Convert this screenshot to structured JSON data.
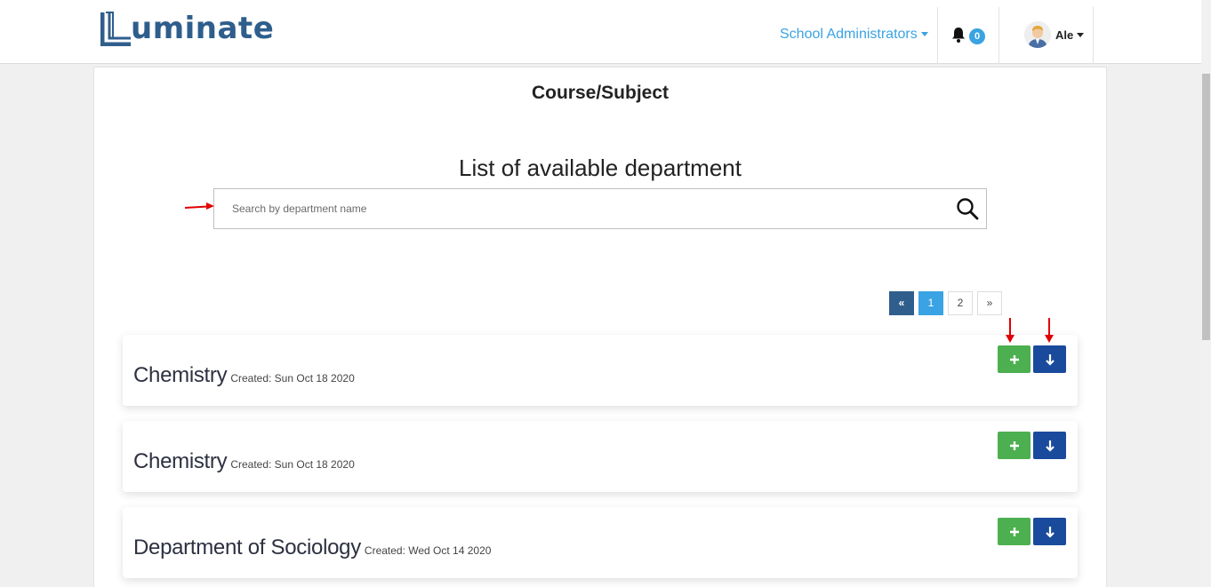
{
  "app": {
    "logo_text": "uminate"
  },
  "nav": {
    "role_label": "School Administrators",
    "notifications_count": "0",
    "user_name": "Ale"
  },
  "page": {
    "title": "Course/Subject",
    "list_title": "List of available department"
  },
  "search": {
    "placeholder": "Search by department name"
  },
  "pagination": {
    "prev": "«",
    "pages": [
      "1",
      "2"
    ],
    "next": "»",
    "active_page": "1"
  },
  "departments": [
    {
      "name": "Chemistry",
      "created": "Created: Sun Oct 18 2020"
    },
    {
      "name": "Chemistry",
      "created": "Created: Sun Oct 18 2020"
    },
    {
      "name": "Department of Sociology",
      "created": "Created: Wed Oct 14 2020"
    }
  ],
  "buttons": {
    "add_icon": "plus-icon",
    "download_icon": "arrow-down-icon"
  },
  "colors": {
    "brand": "#2f5e8c",
    "accent": "#3aa3e3",
    "add_button": "#4caf50",
    "download_button": "#1a4a9c",
    "annotation": "#e00000"
  }
}
